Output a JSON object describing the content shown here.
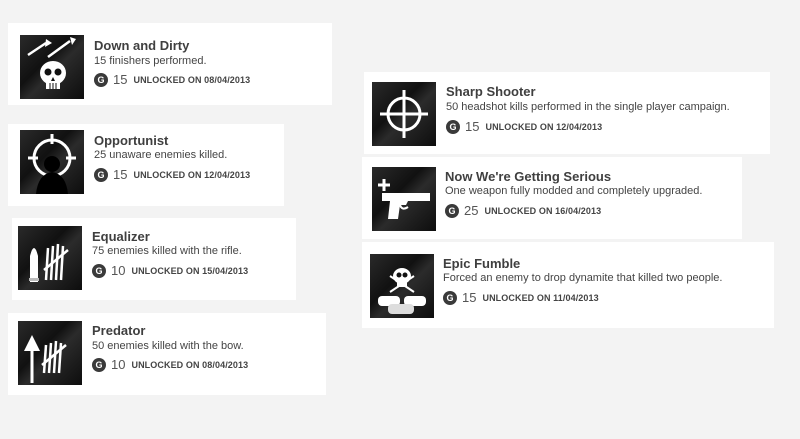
{
  "achievements": [
    {
      "title": "Down and Dirty",
      "desc": "15 finishers performed.",
      "gamerscore": "15",
      "unlocked": "UNLOCKED ON 08/04/2013",
      "icon": "skull-arrows-icon"
    },
    {
      "title": "Opportunist",
      "desc": "25 unaware enemies killed.",
      "gamerscore": "15",
      "unlocked": "UNLOCKED ON 12/04/2013",
      "icon": "crosshair-silhouette-icon"
    },
    {
      "title": "Equalizer",
      "desc": "75 enemies killed with the rifle.",
      "gamerscore": "10",
      "unlocked": "UNLOCKED ON 15/04/2013",
      "icon": "bullet-tally-icon"
    },
    {
      "title": "Predator",
      "desc": "50 enemies killed with the bow.",
      "gamerscore": "10",
      "unlocked": "UNLOCKED ON 08/04/2013",
      "icon": "arrow-tally-icon"
    },
    {
      "title": "Sharp Shooter",
      "desc": "50 headshot kills performed in the single player campaign.",
      "gamerscore": "15",
      "unlocked": "UNLOCKED ON 12/04/2013",
      "icon": "crosshair-icon"
    },
    {
      "title": "Now We're Getting Serious",
      "desc": "One weapon fully modded and completely upgraded.",
      "gamerscore": "25",
      "unlocked": "UNLOCKED ON 16/04/2013",
      "icon": "pistol-plus-icon"
    },
    {
      "title": "Epic Fumble",
      "desc": "Forced an enemy to drop dynamite that killed two people.",
      "gamerscore": "15",
      "unlocked": "UNLOCKED ON 11/04/2013",
      "icon": "skull-dynamite-icon"
    }
  ],
  "gamerscore_glyph": "G"
}
